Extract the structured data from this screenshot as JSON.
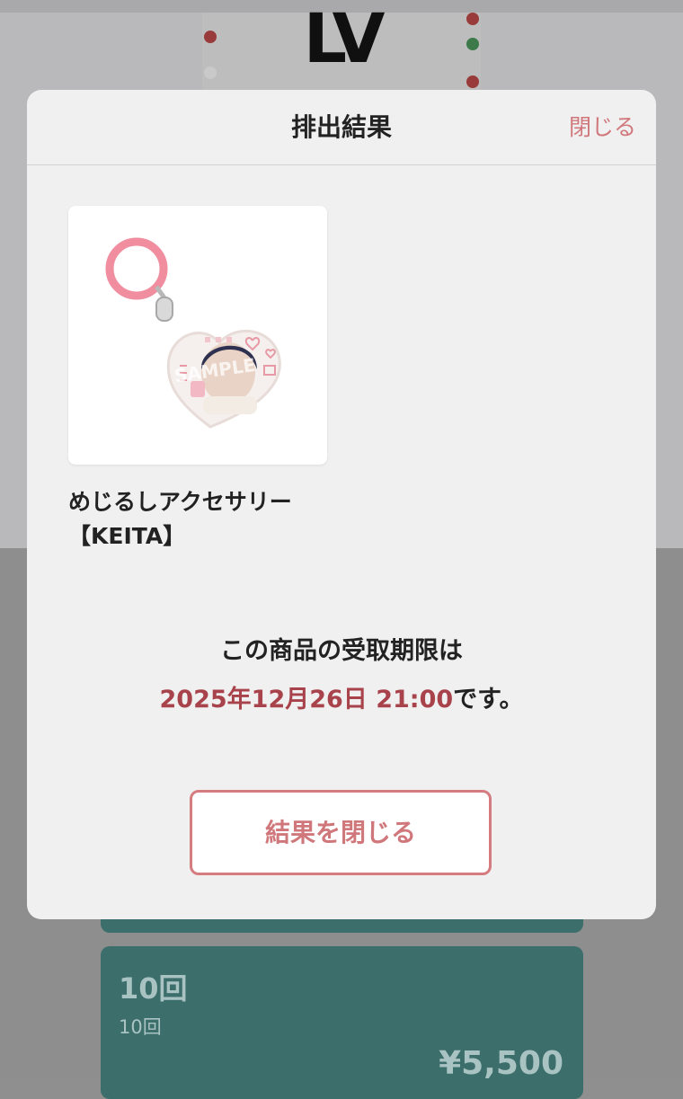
{
  "background": {
    "logo_text": "LV",
    "plans": [
      {
        "title": "10回",
        "subtitle": "10回",
        "price": "¥5,500"
      }
    ]
  },
  "modal": {
    "title": "排出結果",
    "close_link": "閉じる",
    "item": {
      "name_line1": "めじるしアクセサリー",
      "name_line2": "【KEITA】",
      "image_watermark": "SAMPLE"
    },
    "deadline": {
      "line1": "この商品の受取期限は",
      "date": "2025年12月26日 21:00",
      "suffix": "です。"
    },
    "close_button": "結果を閉じる"
  },
  "colors": {
    "accent": "#d0777b",
    "deadline": "#a8434b",
    "plan_card": "#3c6e6c"
  }
}
